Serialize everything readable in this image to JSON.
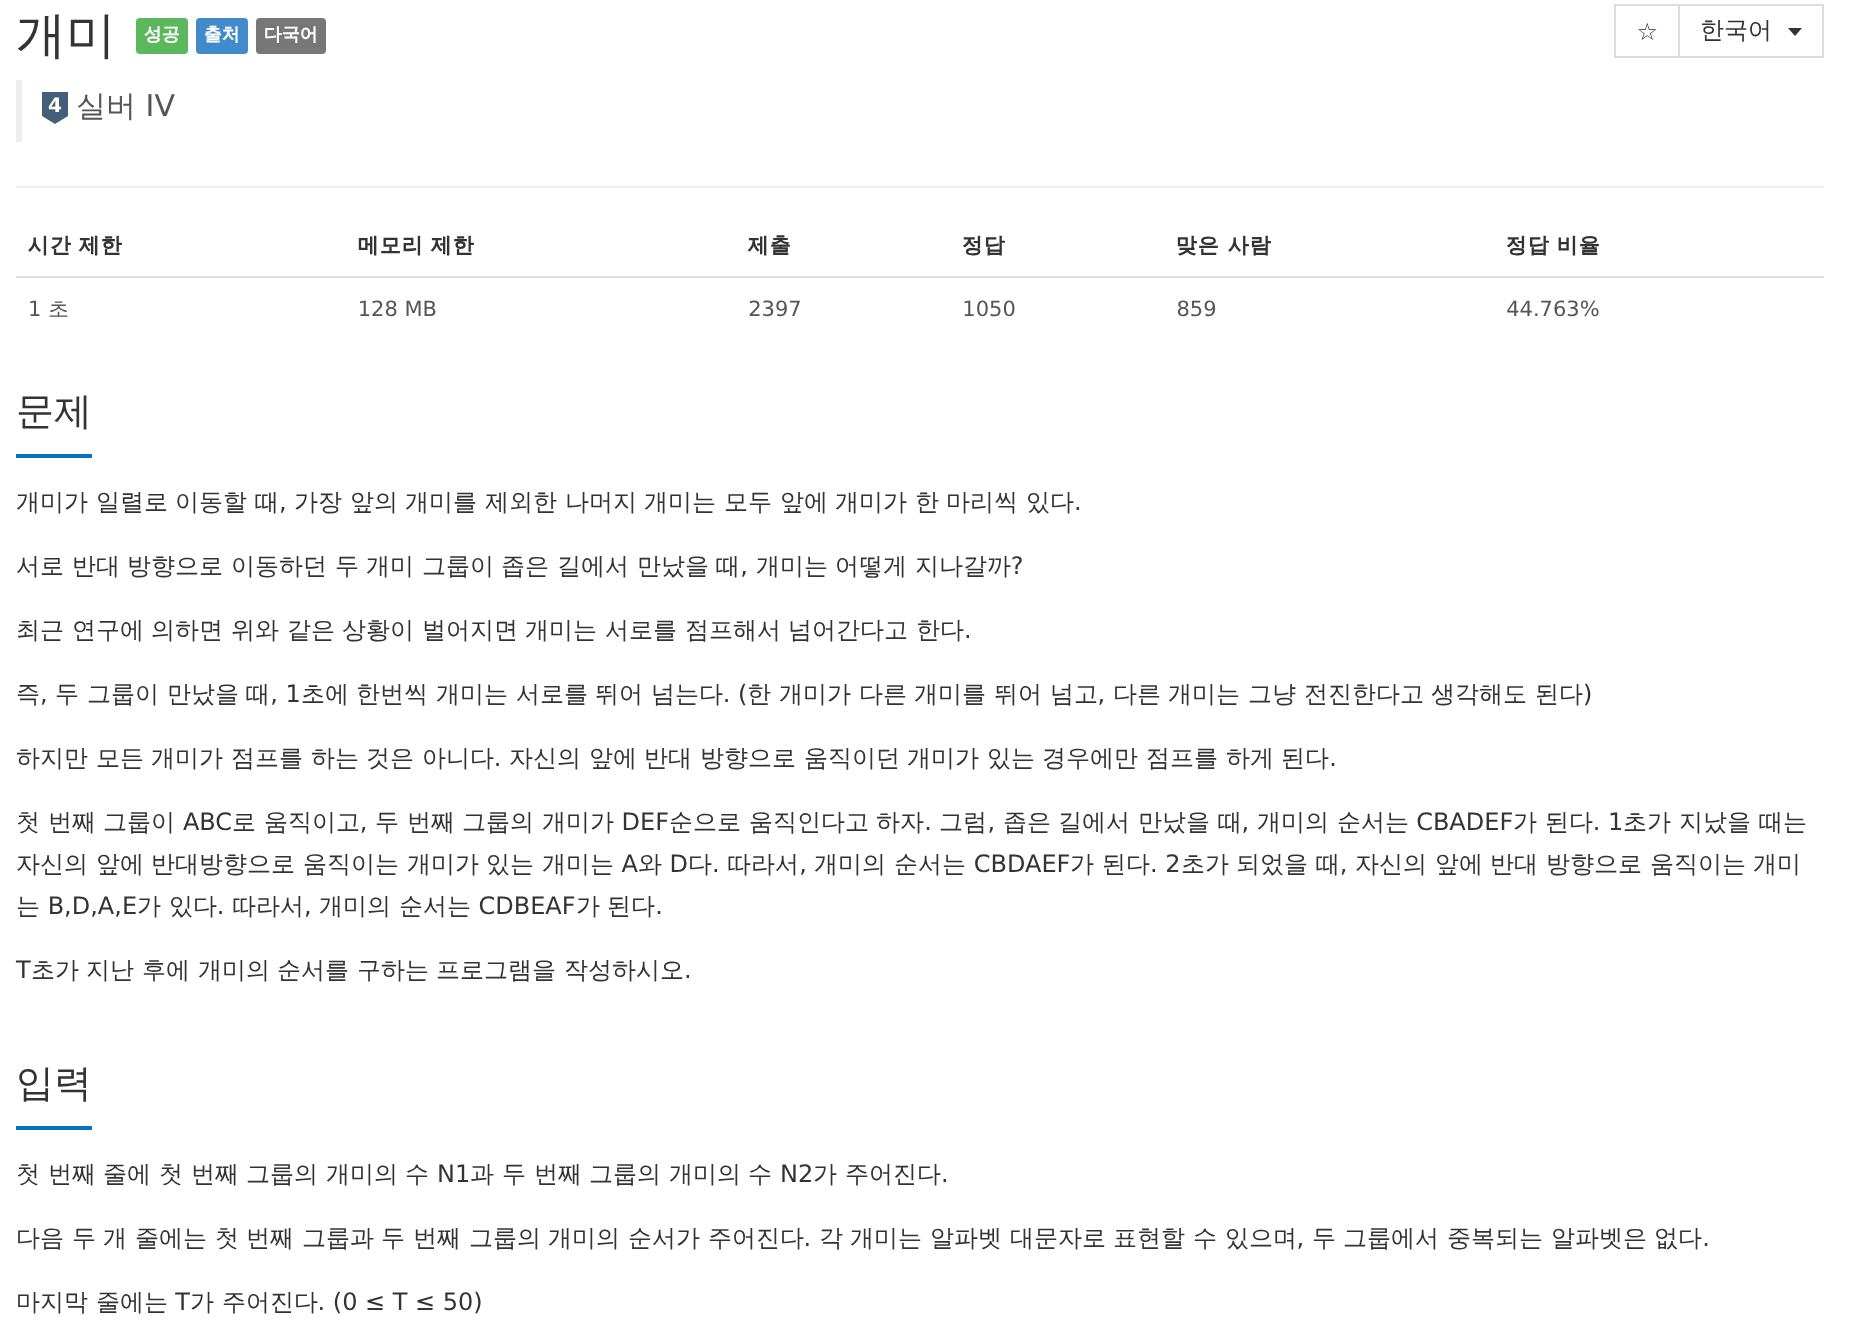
{
  "title": "개미",
  "labels": [
    {
      "text": "성공",
      "color": "#5cb85c"
    },
    {
      "text": "출처",
      "color": "#428bca"
    },
    {
      "text": "다국어",
      "color": "#777777"
    }
  ],
  "tier": {
    "number": "4",
    "name": "실버 IV"
  },
  "star_button": "☆",
  "language": {
    "value": "한국어"
  },
  "stats": {
    "columns": [
      "시간 제한",
      "메모리 제한",
      "제출",
      "정답",
      "맞은 사람",
      "정답 비율"
    ],
    "row": [
      "1 초",
      "128 MB",
      "2397",
      "1050",
      "859",
      "44.763%"
    ]
  },
  "sections": [
    {
      "heading": "문제",
      "paragraphs": [
        "개미가 일렬로 이동할 때, 가장 앞의 개미를 제외한 나머지 개미는 모두 앞에 개미가 한 마리씩 있다.",
        "서로 반대 방향으로 이동하던 두 개미 그룹이 좁은 길에서 만났을 때, 개미는 어떻게 지나갈까?",
        "최근 연구에 의하면 위와 같은 상황이 벌어지면 개미는 서로를 점프해서 넘어간다고 한다.",
        "즉, 두 그룹이 만났을 때, 1초에 한번씩 개미는 서로를 뛰어 넘는다. (한 개미가 다른 개미를 뛰어 넘고, 다른 개미는 그냥 전진한다고 생각해도 된다)",
        "하지만 모든 개미가 점프를 하는 것은 아니다. 자신의 앞에 반대 방향으로 움직이던 개미가 있는 경우에만 점프를 하게 된다.",
        "첫 번째 그룹이 ABC로 움직이고, 두 번째 그룹의 개미가 DEF순으로 움직인다고 하자. 그럼, 좁은 길에서 만났을 때, 개미의 순서는 CBADEF가 된다. 1초가 지났을 때는 자신의 앞에 반대방향으로 움직이는 개미가 있는 개미는 A와 D다. 따라서, 개미의 순서는 CBDAEF가 된다. 2초가 되었을 때, 자신의 앞에 반대 방향으로 움직이는 개미는 B,D,A,E가 있다. 따라서, 개미의 순서는 CDBEAF가 된다.",
        "T초가 지난 후에 개미의 순서를 구하는 프로그램을 작성하시오."
      ]
    },
    {
      "heading": "입력",
      "paragraphs": [
        "첫 번째 줄에 첫 번째 그룹의 개미의 수 N1과 두 번째 그룹의 개미의 수 N2가 주어진다.",
        "다음 두 개 줄에는 첫 번째 그룹과 두 번째 그룹의 개미의 순서가 주어진다. 각 개미는 알파벳 대문자로 표현할 수 있으며, 두 그룹에서 중복되는 알파벳은 없다.",
        "마지막 줄에는 T가 주어진다. (0 ≤ T ≤ 50)"
      ]
    }
  ]
}
